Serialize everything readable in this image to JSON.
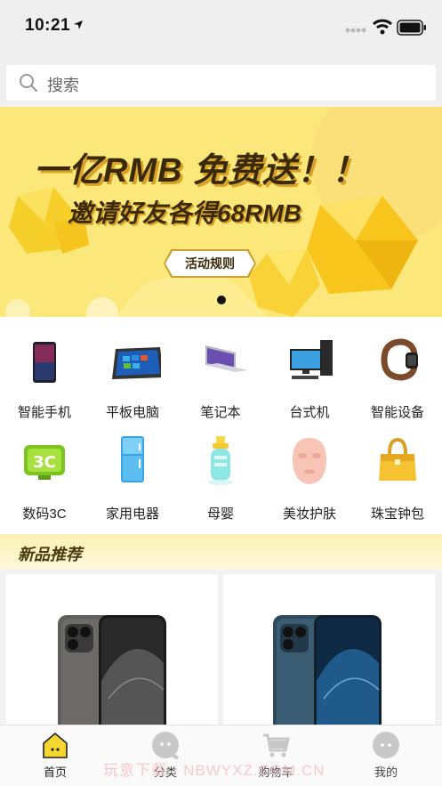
{
  "status": {
    "time": "10:21"
  },
  "search": {
    "placeholder": "搜索"
  },
  "banner": {
    "line1": "一亿RMB  免费送！！",
    "line2": "邀请好友各得68RMB",
    "rules_button": "活动规则"
  },
  "categories": [
    {
      "label": "智能手机",
      "icon": "smartphone-icon"
    },
    {
      "label": "平板电脑",
      "icon": "tablet-icon"
    },
    {
      "label": "笔记本",
      "icon": "laptop-icon"
    },
    {
      "label": "台式机",
      "icon": "desktop-icon"
    },
    {
      "label": "智能设备",
      "icon": "smartwatch-icon"
    },
    {
      "label": "数码3C",
      "icon": "3c-icon"
    },
    {
      "label": "家用电器",
      "icon": "fridge-icon"
    },
    {
      "label": "母婴",
      "icon": "baby-bottle-icon"
    },
    {
      "label": "美妆护肤",
      "icon": "face-mask-icon"
    },
    {
      "label": "珠宝钟包",
      "icon": "handbag-icon"
    }
  ],
  "section": {
    "title": "新品推荐"
  },
  "tabs": [
    {
      "label": "首页",
      "icon": "home-icon",
      "active": true
    },
    {
      "label": "分类",
      "icon": "category-icon",
      "active": false
    },
    {
      "label": "购物车",
      "icon": "cart-icon",
      "active": false
    },
    {
      "label": "我的",
      "icon": "profile-icon",
      "active": false
    }
  ],
  "watermark": "玩意下载 · NBWYXZ.COM.CN",
  "colors": {
    "accent": "#fce77a",
    "banner_text": "#3a2a08",
    "tab_active": "#f5d631"
  }
}
